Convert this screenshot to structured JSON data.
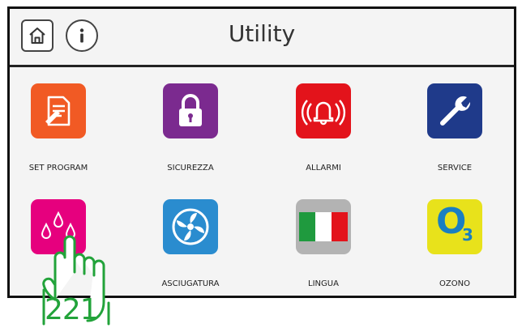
{
  "header": {
    "title": "Utility",
    "home_icon": "home-icon",
    "info_icon": "info-icon"
  },
  "tiles": [
    {
      "label": "SET PROGRAM",
      "icon": "document-edit-icon",
      "color": "#f15a24"
    },
    {
      "label": "SICUREZZA",
      "icon": "padlock-icon",
      "color": "#7b2a8f"
    },
    {
      "label": "ALLARMI",
      "icon": "alarm-bell-icon",
      "color": "#e3131b"
    },
    {
      "label": "SERVICE",
      "icon": "wrench-icon",
      "color": "#1f3a8a"
    },
    {
      "label": "",
      "icon": "water-drops-icon",
      "color": "#e6007e"
    },
    {
      "label": "ASCIUGATURA",
      "icon": "fan-icon",
      "color": "#2a8ccf"
    },
    {
      "label": "LINGUA",
      "icon": "italian-flag-icon",
      "color": "#b3b3b3"
    },
    {
      "label": "OZONO",
      "icon": "ozone-o3-icon",
      "color": "#e8e21b"
    }
  ],
  "ozone_text": {
    "o": "O",
    "sub": "3"
  },
  "overlay": {
    "number": "221",
    "icon": "pointing-hand-icon",
    "color": "#22a33a"
  }
}
